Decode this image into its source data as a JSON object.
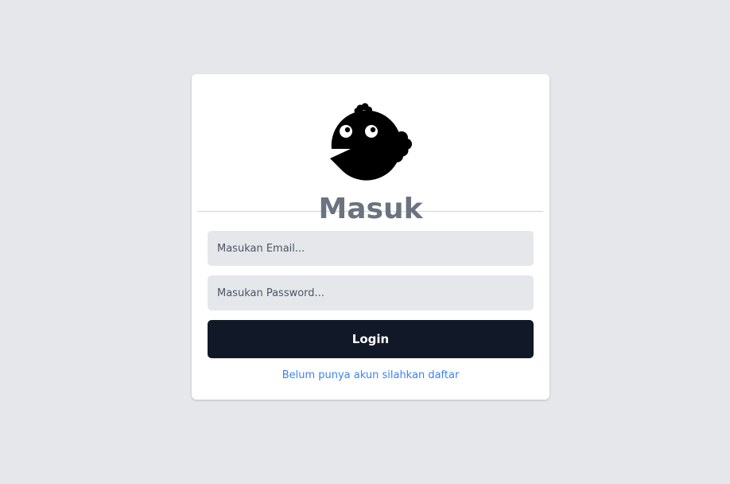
{
  "login": {
    "title": "Masuk",
    "email_placeholder": "Masukan Email...",
    "password_placeholder": "Masukan Password...",
    "login_label": "Login",
    "register_link": "Belum punya akun silahkan daftar"
  },
  "colors": {
    "background": "#e5e7eb",
    "card": "#ffffff",
    "button": "#111827",
    "link": "#3b82f6",
    "title": "#6b7280"
  },
  "icons": {
    "logo": "bird-logo-icon"
  }
}
